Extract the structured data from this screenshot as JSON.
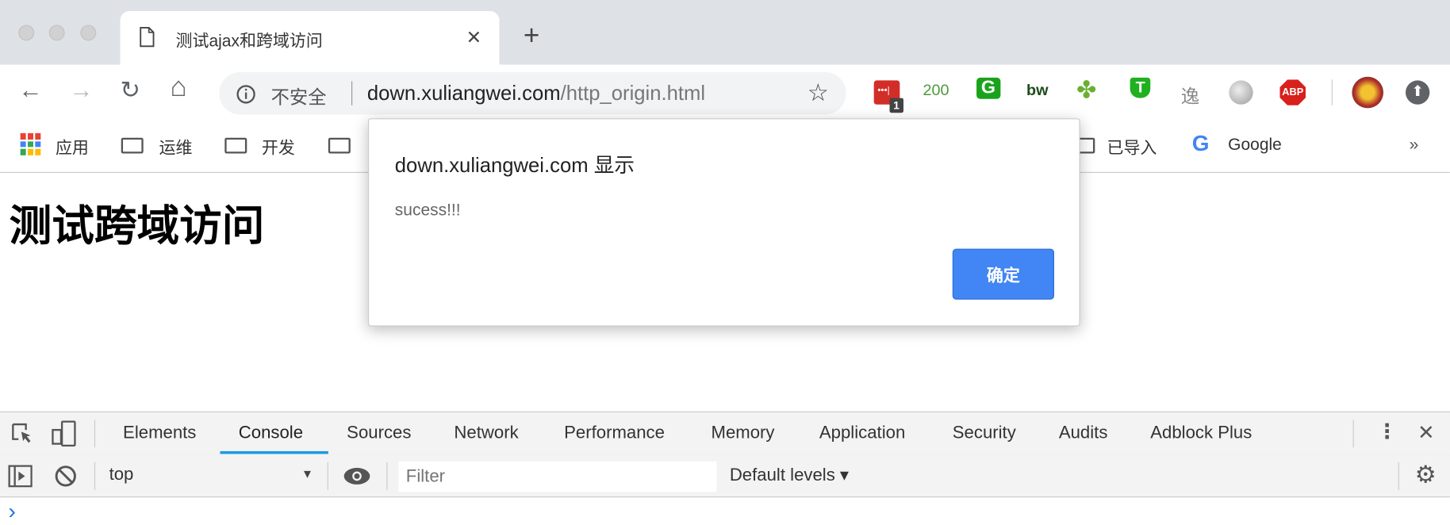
{
  "browser": {
    "tab": {
      "title": "测试ajax和跨域访问",
      "close": "✕",
      "new_tab": "+"
    },
    "nav": {
      "back": "←",
      "forward": "→",
      "reload": "↻",
      "home": "⌂"
    },
    "omnibox": {
      "security_label": "不安全",
      "url_host": "down.xuliangwei.com",
      "url_path": "/http_origin.html"
    },
    "extensions": [
      {
        "icon": "lastpass-icon",
        "badge": "1"
      },
      {
        "icon": "status-200-icon",
        "label": "200"
      },
      {
        "icon": "g-extension-icon",
        "label": "G"
      },
      {
        "icon": "bw-extension-icon",
        "label": "bw"
      },
      {
        "icon": "clover-icon"
      },
      {
        "icon": "shield-t-icon",
        "label": "T"
      },
      {
        "icon": "calligraphy-icon",
        "label": "逸"
      },
      {
        "icon": "globe-icon"
      },
      {
        "icon": "adblock-plus-icon",
        "label": "ABP"
      },
      {
        "icon": "avatar-icon"
      },
      {
        "icon": "update-arrow-icon"
      }
    ],
    "bookmarks": [
      {
        "icon": "apps-grid-icon",
        "label": "应用"
      },
      {
        "icon": "folder-icon",
        "label": "运维"
      },
      {
        "icon": "folder-icon",
        "label": "开发"
      },
      {
        "icon": "folder-icon",
        "label": ""
      },
      {
        "icon": "folder-icon",
        "label": "已导入"
      },
      {
        "icon": "google-icon",
        "label": "Google"
      }
    ],
    "bookmarks_overflow": "»"
  },
  "page": {
    "heading": "测试跨域访问"
  },
  "dialog": {
    "title": "down.xuliangwei.com 显示",
    "message": "sucess!!!",
    "ok_label": "确定",
    "accent": "#4285f4"
  },
  "devtools": {
    "tabs": [
      "Elements",
      "Console",
      "Sources",
      "Network",
      "Performance",
      "Memory",
      "Application",
      "Security",
      "Audits",
      "Adblock Plus"
    ],
    "active_tab": "Console",
    "context": "top",
    "filter_placeholder": "Filter",
    "levels": "Default levels ▾",
    "prompt": "›"
  }
}
